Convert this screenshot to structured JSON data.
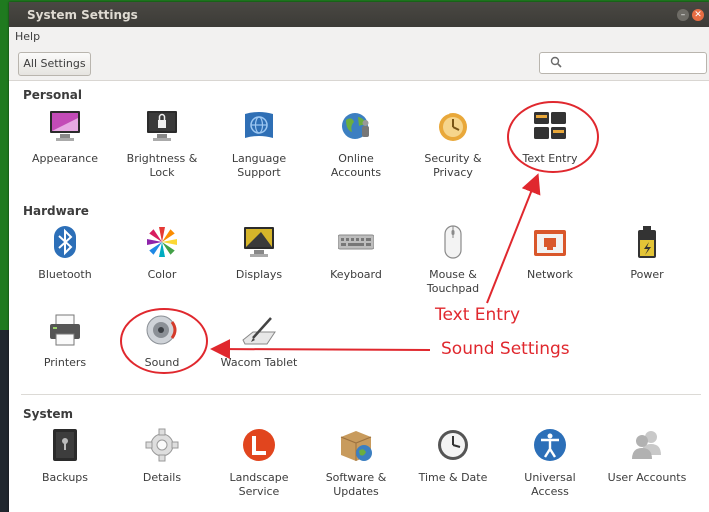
{
  "window": {
    "title": "System Settings",
    "close_icon": "close-icon",
    "min_icon": "minimize-icon"
  },
  "menubar": {
    "help": "Help"
  },
  "toolbar": {
    "all_settings": "All Settings",
    "search_placeholder": "",
    "search_icon": "search-icon"
  },
  "sections": {
    "personal": "Personal",
    "hardware": "Hardware",
    "system": "System"
  },
  "personal_items": [
    {
      "label": "Appearance",
      "icon": "appearance-icon"
    },
    {
      "label": "Brightness &\nLock",
      "icon": "brightness-lock-icon"
    },
    {
      "label": "Language\nSupport",
      "icon": "language-support-icon"
    },
    {
      "label": "Online\nAccounts",
      "icon": "online-accounts-icon"
    },
    {
      "label": "Security &\nPrivacy",
      "icon": "security-privacy-icon"
    },
    {
      "label": "Text Entry",
      "icon": "text-entry-icon"
    }
  ],
  "hardware_items": [
    {
      "label": "Bluetooth",
      "icon": "bluetooth-icon"
    },
    {
      "label": "Color",
      "icon": "color-icon"
    },
    {
      "label": "Displays",
      "icon": "displays-icon"
    },
    {
      "label": "Keyboard",
      "icon": "keyboard-icon"
    },
    {
      "label": "Mouse &\nTouchpad",
      "icon": "mouse-touchpad-icon"
    },
    {
      "label": "Network",
      "icon": "network-icon"
    },
    {
      "label": "Power",
      "icon": "power-icon"
    },
    {
      "label": "Printers",
      "icon": "printers-icon"
    },
    {
      "label": "Sound",
      "icon": "sound-icon"
    },
    {
      "label": "Wacom Tablet",
      "icon": "wacom-tablet-icon"
    }
  ],
  "system_items": [
    {
      "label": "Backups",
      "icon": "backups-icon"
    },
    {
      "label": "Details",
      "icon": "details-icon"
    },
    {
      "label": "Landscape\nService",
      "icon": "landscape-service-icon"
    },
    {
      "label": "Software &\nUpdates",
      "icon": "software-updates-icon"
    },
    {
      "label": "Time & Date",
      "icon": "time-date-icon"
    },
    {
      "label": "Universal\nAccess",
      "icon": "universal-access-icon"
    },
    {
      "label": "User Accounts",
      "icon": "user-accounts-icon"
    }
  ],
  "annotations": {
    "text_entry": "Text Entry",
    "sound_settings": "Sound Settings",
    "color": "#e0282e"
  }
}
